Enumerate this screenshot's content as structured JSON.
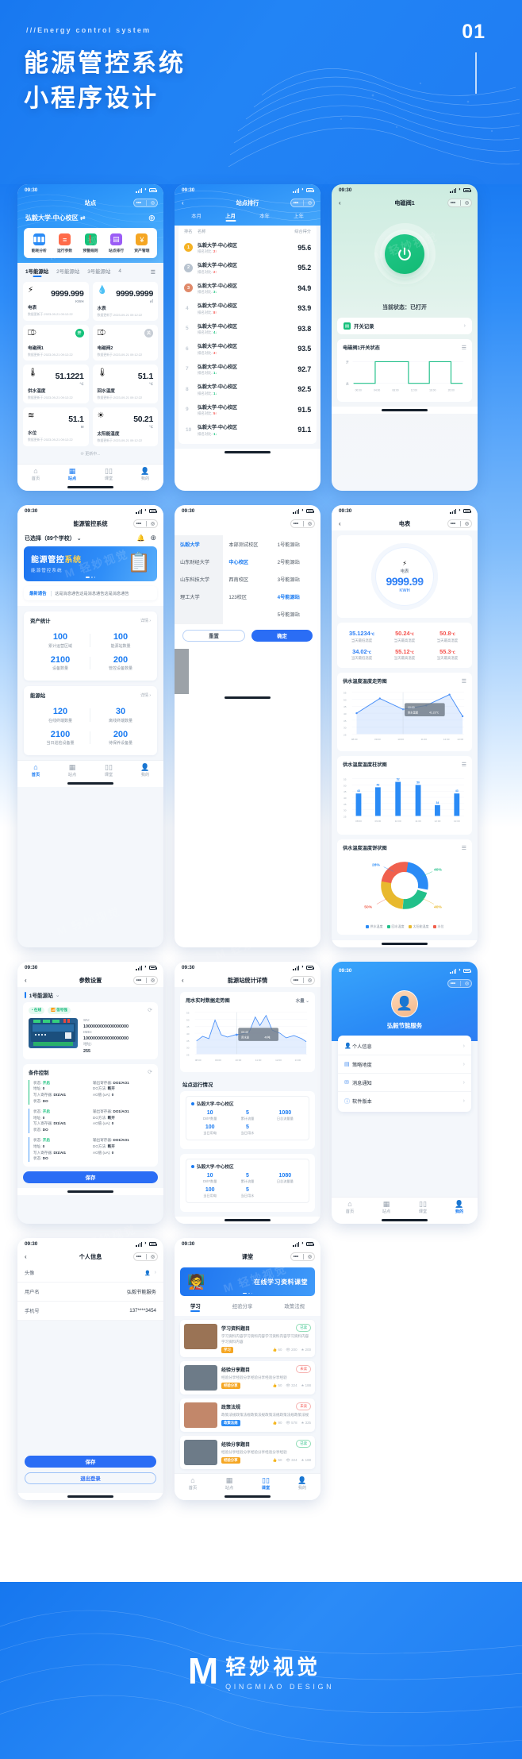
{
  "hero": {
    "eyebrow": "///Energy control system",
    "title": "能源管控系统\n小程序设计",
    "number": "01"
  },
  "statusbar": {
    "time": "09:30",
    "icons": [
      "signal-icon",
      "wifi-icon",
      "battery-icon"
    ]
  },
  "capsule": {
    "dots": "•••",
    "target": "◎"
  },
  "phones": {
    "p1": {
      "title": "站点",
      "site_name": "弘毅大学-中心校区",
      "swap_icon": "⇄",
      "add_icon": "⊕",
      "menu": [
        {
          "label": "能耗分析",
          "icon": "▮▮▮",
          "color": "#2a8bf6"
        },
        {
          "label": "运行参数",
          "icon": "≡",
          "color": "#ff6b4a"
        },
        {
          "label": "预警规则",
          "icon": "❗",
          "color": "#14c27a"
        },
        {
          "label": "站点排行",
          "icon": "▤",
          "color": "#9b5cf6"
        },
        {
          "label": "资产管理",
          "icon": "¥",
          "color": "#f5a623"
        }
      ],
      "tabs": [
        "1号能源站",
        "2号能源站",
        "3号能源站",
        "4"
      ],
      "tab_active": 0,
      "list_icon": "☰",
      "cells": [
        {
          "name": "电表",
          "icon": "⚡",
          "value": "9999.999",
          "unit": "KWH",
          "ts": "数据更新于:2023-09-21 09:12:22",
          "kind": "value"
        },
        {
          "name": "水表",
          "icon": "💧",
          "value": "9999.9999",
          "unit": "㎡",
          "ts": "数据更新于:2023-09-21 09:12:22",
          "kind": "value"
        },
        {
          "name": "电磁阀1",
          "icon": "⎄",
          "state": "开",
          "on": true,
          "ts": "数据更新于:2023-09-21 09:12:22",
          "kind": "switch"
        },
        {
          "name": "电磁阀2",
          "icon": "⎄",
          "state": "关",
          "on": false,
          "ts": "数据更新于:2023-09-21 09:12:22",
          "kind": "switch"
        },
        {
          "name": "供水温度",
          "icon": "🌡",
          "value": "51.1221",
          "unit": "℃",
          "ts": "数据更新于:2023-09-21 09:12:22",
          "kind": "value"
        },
        {
          "name": "回水温度",
          "icon": "🌡",
          "value": "51.1",
          "unit": "℃",
          "ts": "数据更新于:2023-09-21 09:12:22",
          "kind": "value"
        },
        {
          "name": "水位",
          "icon": "≋",
          "value": "51.1",
          "unit": "M",
          "ts": "数据更新于:2023-09-21 09:12:22",
          "kind": "value"
        },
        {
          "name": "太阳能温度",
          "icon": "☀",
          "value": "50.21",
          "unit": "℃",
          "ts": "数据更新于:2023-09-21 09:12:22",
          "kind": "value"
        }
      ],
      "refresh_text": "⟳ 更新中...",
      "tabbar": [
        {
          "label": "首页",
          "icon": "⌂",
          "active": false
        },
        {
          "label": "站点",
          "icon": "▦",
          "active": true
        },
        {
          "label": "课堂",
          "icon": "▯▯",
          "active": false
        },
        {
          "label": "我的",
          "icon": "👤",
          "active": false
        }
      ]
    },
    "p2": {
      "title": "站点排行",
      "tabs": [
        "本月",
        "上月",
        "本年",
        "上年"
      ],
      "tab_active": 1,
      "headers": [
        "排名",
        "名称",
        "综合得分"
      ],
      "compare_label": "排名对比:",
      "rows": [
        {
          "rank": "1",
          "name": "弘毅大学-中心校区",
          "delta": "2",
          "dir": "up",
          "score": "95.6",
          "medal": "#f5b224"
        },
        {
          "rank": "2",
          "name": "弘毅大学-中心校区",
          "delta": "2",
          "dir": "up",
          "score": "95.2",
          "medal": "#b8c3cf"
        },
        {
          "rank": "3",
          "name": "弘毅大学-中心校区",
          "delta": "3",
          "dir": "down",
          "score": "94.9",
          "medal": "#e08a6a"
        },
        {
          "rank": "4",
          "name": "弘毅大学-中心校区",
          "delta": "8",
          "dir": "up",
          "score": "93.9",
          "medal": ""
        },
        {
          "rank": "5",
          "name": "弘毅大学-中心校区",
          "delta": "4",
          "dir": "down",
          "score": "93.8",
          "medal": ""
        },
        {
          "rank": "6",
          "name": "弘毅大学-中心校区",
          "delta": "3",
          "dir": "up",
          "score": "93.5",
          "medal": ""
        },
        {
          "rank": "7",
          "name": "弘毅大学-中心校区",
          "delta": "1",
          "dir": "down",
          "score": "92.7",
          "medal": ""
        },
        {
          "rank": "8",
          "name": "弘毅大学-中心校区",
          "delta": "1",
          "dir": "down",
          "score": "92.5",
          "medal": ""
        },
        {
          "rank": "9",
          "name": "弘毅大学-中心校区",
          "delta": "5",
          "dir": "up",
          "score": "91.5",
          "medal": ""
        },
        {
          "rank": "10",
          "name": "弘毅大学-中心校区",
          "delta": "1",
          "dir": "down",
          "score": "91.1",
          "medal": ""
        }
      ]
    },
    "p3": {
      "title": "电磁阀1",
      "power_icon": "⏻",
      "state_label": "当前状态：已打开",
      "record_row": {
        "label": "开关记录",
        "icon": "▤",
        "arrow": "›"
      },
      "chart_title": "电磁阀1开关状态",
      "menu_icon": "☰"
    },
    "p4": {
      "title": "能源管控系统",
      "selector": "已选择（89个学校）",
      "chevron": "⌄",
      "bell_icon": "🔔",
      "add_icon": "⊕",
      "banner": {
        "title_a": "能源管控",
        "title_b": "系统",
        "sub": "能源管控系统"
      },
      "notice": {
        "tag": "最新通告",
        "text": "这是消息通告这是消息通告这是消息通告"
      },
      "asset": {
        "title": "资产统计",
        "more": "详情 ›",
        "items": [
          {
            "value": "100",
            "label": "累计运营区域"
          },
          {
            "value": "100",
            "label": "能源站数量"
          },
          {
            "value": "2100",
            "label": "设备数量"
          },
          {
            "value": "200",
            "label": "管控设备数量"
          }
        ]
      },
      "station": {
        "title": "能源站",
        "more": "详情 ›",
        "items": [
          {
            "value": "120",
            "label": "在线终端数量"
          },
          {
            "value": "30",
            "label": "离线终端数量"
          },
          {
            "value": "2100",
            "label": "当日巡检设备量"
          },
          {
            "value": "200",
            "label": "待保养设备量"
          }
        ]
      },
      "tabbar": [
        {
          "label": "首页",
          "icon": "⌂",
          "active": true
        },
        {
          "label": "站点",
          "icon": "▦",
          "active": false
        },
        {
          "label": "课堂",
          "icon": "▯▯",
          "active": false
        },
        {
          "label": "我的",
          "icon": "👤",
          "active": false
        }
      ]
    },
    "p5": {
      "col_schools": [
        "弘毅大学",
        "山东财经大学",
        "山东科技大学",
        "理工大学"
      ],
      "col_campus": [
        "本部测试校区",
        "中心校区",
        "西南校区",
        "123校区"
      ],
      "col_stations": [
        "1号能源站",
        "2号能源站",
        "3号能源站",
        "4号能源站",
        "5号能源站"
      ],
      "sel_school": 0,
      "sel_campus": 1,
      "sel_station": 3,
      "reset_label": "重置",
      "confirm_label": "确定"
    },
    "p6": {
      "title": "电表",
      "gauge": {
        "icon": "⚡",
        "name": "电表",
        "value": "9999.99",
        "unit": "KWH"
      },
      "temps": [
        {
          "value": "35.1234",
          "unit": "℃",
          "label": "当天最低温度",
          "color": "#2a7df5"
        },
        {
          "value": "50.24",
          "unit": "℃",
          "label": "当天最高温度",
          "color": "#f4524d"
        },
        {
          "value": "50.8",
          "unit": "℃",
          "label": "当天最高温度",
          "color": "#f4524d"
        },
        {
          "value": "34.02",
          "unit": "℃",
          "label": "当天最低温度",
          "color": "#2a7df5"
        },
        {
          "value": "55.12",
          "unit": "℃",
          "label": "当天最高温度",
          "color": "#f4524d"
        },
        {
          "value": "55.3",
          "unit": "℃",
          "label": "当天最高温度",
          "color": "#f4524d"
        }
      ],
      "chart_area_title": "供水温度温度走势图",
      "chart_bar_title": "供水温度温度柱状图",
      "chart_pie_title": "供水温度温度饼状图",
      "menu_icon": "☰",
      "tooltip": {
        "time": "10:00",
        "name": "供水温度",
        "value": "41.23℃"
      },
      "legend": [
        "供水温度",
        "回水温度",
        "太阳能温度",
        "水位"
      ]
    },
    "p7": {
      "title": "参数设置",
      "station": "1号能源站",
      "chevron": "⌄",
      "badges": [
        "• 在线",
        "📶 信号强"
      ],
      "refresh_icon": "⟳",
      "device": {
        "sn_label": "SN:",
        "sn": "1000000000000000000",
        "imei_label": "IMEI:",
        "imei": "1000000000000000000",
        "addr_label": "地址:",
        "addr": "255"
      },
      "cond_title": "条件控制",
      "blocks": [
        {
          "state_label": "状态:",
          "state": "开启",
          "reg_label": "输出寄存器:",
          "reg": "DO1/AO1",
          "addr_label": "地址:",
          "addr": "0",
          "method_label": "DO方法:",
          "method": "断开",
          "fn_label": "写入寄存器:",
          "fn": "DI1/AI1",
          "ao_label": "AO值 (uA):",
          "ao": "0",
          "rs_label": "状态:",
          "rs": "DO",
          "color": "#17c07c"
        },
        {
          "state_label": "状态:",
          "state": "开启",
          "reg_label": "输出寄存器:",
          "reg": "DO1/AO1",
          "addr_label": "地址:",
          "addr": "0",
          "method_label": "DO方法:",
          "method": "断开",
          "fn_label": "写入寄存器:",
          "fn": "DI1/AI1",
          "ao_label": "AO值 (uA):",
          "ao": "0",
          "rs_label": "状态:",
          "rs": "DO",
          "color": "#4a9cf8"
        },
        {
          "state_label": "状态:",
          "state": "开启",
          "reg_label": "输出寄存器:",
          "reg": "DO1/AO1",
          "addr_label": "地址:",
          "addr": "0",
          "method_label": "DO方法:",
          "method": "断开",
          "fn_label": "写入寄存器:",
          "fn": "DI1/AI1",
          "ao_label": "AO值 (uA):",
          "ao": "0",
          "rs_label": "状态:",
          "rs": "DO",
          "color": "#4a9cf8"
        }
      ],
      "save_label": "保存"
    },
    "p8": {
      "title": "能源站统计详情",
      "chart_title": "用水实时数据走势图",
      "chart_select": "水量 ⌄",
      "tooltip": {
        "time": "09:45",
        "name": "用水量",
        "value": "40吨"
      },
      "section_title": "站点运行情况",
      "items": [
        {
          "name": "弘毅大学-中心校区",
          "stats": [
            {
              "value": "10",
              "label": "DI/IF数量"
            },
            {
              "value": "5",
              "label": "累计流量"
            },
            {
              "value": "1080",
              "label": "日总流量量"
            },
            {
              "value": "100",
              "label": "当日用电"
            },
            {
              "value": "5",
              "label": "当日用水"
            },
            {
              "value": "",
              "label": ""
            }
          ]
        },
        {
          "name": "弘毅大学-中心校区",
          "stats": [
            {
              "value": "10",
              "label": "DI/IF数量"
            },
            {
              "value": "5",
              "label": "累计流量"
            },
            {
              "value": "1080",
              "label": "日总流量量"
            },
            {
              "value": "100",
              "label": "当日用电"
            },
            {
              "value": "5",
              "label": "当日用水"
            },
            {
              "value": "",
              "label": ""
            }
          ]
        }
      ]
    },
    "p9": {
      "user_name": "弘毅节能服务",
      "avatar_icon": "👤",
      "items": [
        {
          "label": "个人信息",
          "icon": "👤"
        },
        {
          "label": "策略地度",
          "icon": "▤"
        },
        {
          "label": "消息通知",
          "icon": "✉"
        },
        {
          "label": "软件版本",
          "icon": "ⓘ"
        }
      ],
      "arrow": "›",
      "tabbar": [
        {
          "label": "首页",
          "icon": "⌂",
          "active": false
        },
        {
          "label": "站点",
          "icon": "▦",
          "active": false
        },
        {
          "label": "课堂",
          "icon": "▯▯",
          "active": false
        },
        {
          "label": "我的",
          "icon": "👤",
          "active": true
        }
      ]
    },
    "p10": {
      "title": "个人信息",
      "rows": [
        {
          "label": "头像",
          "value": "👤",
          "arrow": "›"
        },
        {
          "label": "用户名",
          "value": "弘毅节能服务",
          "arrow": ""
        },
        {
          "label": "手机号",
          "value": "137****3454",
          "arrow": ""
        }
      ],
      "save_label": "保存",
      "logout_label": "退出登录"
    },
    "p11": {
      "title": "课堂",
      "banner_title": "在线学习资料课堂",
      "tabs": [
        "学习",
        "经验分享",
        "政策法规"
      ],
      "tab_active": 0,
      "items": [
        {
          "title": "学习资料题目",
          "status": "已读",
          "read": true,
          "desc": "学习资料内容学习资料内容学习资料内容学习资料内容学习资料内容",
          "tag": "学习",
          "tag_color": "#f5a623",
          "likes": "60",
          "views": "200",
          "stars": "200",
          "thumb": "#9a7355"
        },
        {
          "title": "经验分享题目",
          "status": "未读",
          "read": false,
          "desc": "经验分享经验分享经验分享经验分享经验",
          "tag": "经验分享",
          "tag_color": "#f5a623",
          "likes": "50",
          "views": "324",
          "stars": "188",
          "thumb": "#6d7b88"
        },
        {
          "title": "政策法规",
          "status": "未读",
          "read": false,
          "desc": "政策法规政策法规政策法规政策法规政策法规政策法规",
          "tag": "政策法规",
          "tag_color": "#2a8bf6",
          "likes": "90",
          "views": "578",
          "stars": "325",
          "thumb": "#c2876a"
        },
        {
          "title": "经验分享题目",
          "status": "已读",
          "read": true,
          "desc": "经验分享经验分享经验分享经验分享经验",
          "tag": "经验分享",
          "tag_color": "#f5a623",
          "likes": "50",
          "views": "324",
          "stars": "188",
          "thumb": "#6d7b88"
        }
      ],
      "meta_icons": {
        "like": "👍",
        "view": "👁",
        "star": "★"
      },
      "tabbar": [
        {
          "label": "首页",
          "icon": "⌂",
          "active": false
        },
        {
          "label": "站点",
          "icon": "▦",
          "active": false
        },
        {
          "label": "课堂",
          "icon": "▯▯",
          "active": true
        },
        {
          "label": "我的",
          "icon": "👤",
          "active": false
        }
      ]
    }
  },
  "chart_data": [
    {
      "id": "valve-state",
      "type": "line",
      "title": "电磁阀1开关状态",
      "x": [
        "00:00",
        "04:00",
        "08:00",
        "12:00",
        "16:00",
        "20:00"
      ],
      "ylabels": [
        "开",
        "关"
      ],
      "values": [
        0,
        0,
        1,
        1,
        0,
        1,
        0
      ],
      "note": "square wave on/off",
      "color": "#17c07c"
    },
    {
      "id": "supply-temp-trend",
      "type": "area",
      "title": "供水温度温度走势图",
      "x": [
        "08:00",
        "09:00",
        "10:00",
        "11:00",
        "12:00",
        "13:00"
      ],
      "values": [
        41,
        51,
        44,
        47,
        54,
        39
      ],
      "ylim": [
        25,
        55
      ],
      "yticks": [
        25,
        30,
        35,
        40,
        45,
        50,
        55
      ],
      "color": "#4a90f8",
      "annotation": "10:00 供水温度 41.23℃"
    },
    {
      "id": "supply-temp-bar",
      "type": "bar",
      "title": "供水温度温度柱状图",
      "categories": [
        "08:00",
        "09:00",
        "10:00",
        "11:00",
        "12:00",
        "13:00"
      ],
      "values": [
        43,
        48,
        52,
        50,
        34,
        43
      ],
      "ylim": [
        25,
        55
      ],
      "yticks": [
        25,
        30,
        35,
        40,
        45,
        50,
        55
      ],
      "color": "#2a8bf6"
    },
    {
      "id": "supply-temp-pie",
      "type": "pie",
      "title": "供水温度温度饼状图",
      "labels": [
        "供水温度",
        "回水温度",
        "太阳能温度",
        "水位"
      ],
      "values": [
        28,
        40,
        40,
        50
      ],
      "display_labels": [
        "28%",
        "40%",
        "40%",
        "50%"
      ],
      "colors": [
        "#2a8bf6",
        "#22c08a",
        "#e8b92e",
        "#f0604d"
      ]
    },
    {
      "id": "water-realtime",
      "type": "area",
      "title": "用水实时数据走势图",
      "x": [
        "08:00",
        "09:00",
        "10:00",
        "11:00",
        "12:00",
        "13:00"
      ],
      "values": [
        38,
        40,
        49,
        40,
        41,
        42,
        53,
        48,
        54,
        43,
        41,
        38,
        40,
        36
      ],
      "ylim": [
        25,
        55
      ],
      "yticks": [
        25,
        30,
        35,
        40,
        45,
        50,
        55
      ],
      "color": "#4a90f8",
      "annotation": "09:45 用水量 40吨"
    }
  ],
  "footer": {
    "logo": "M",
    "brand_cn": "轻妙视觉",
    "brand_en": "QINGMIAO DESIGN"
  },
  "watermark": "M 轻妙视觉"
}
